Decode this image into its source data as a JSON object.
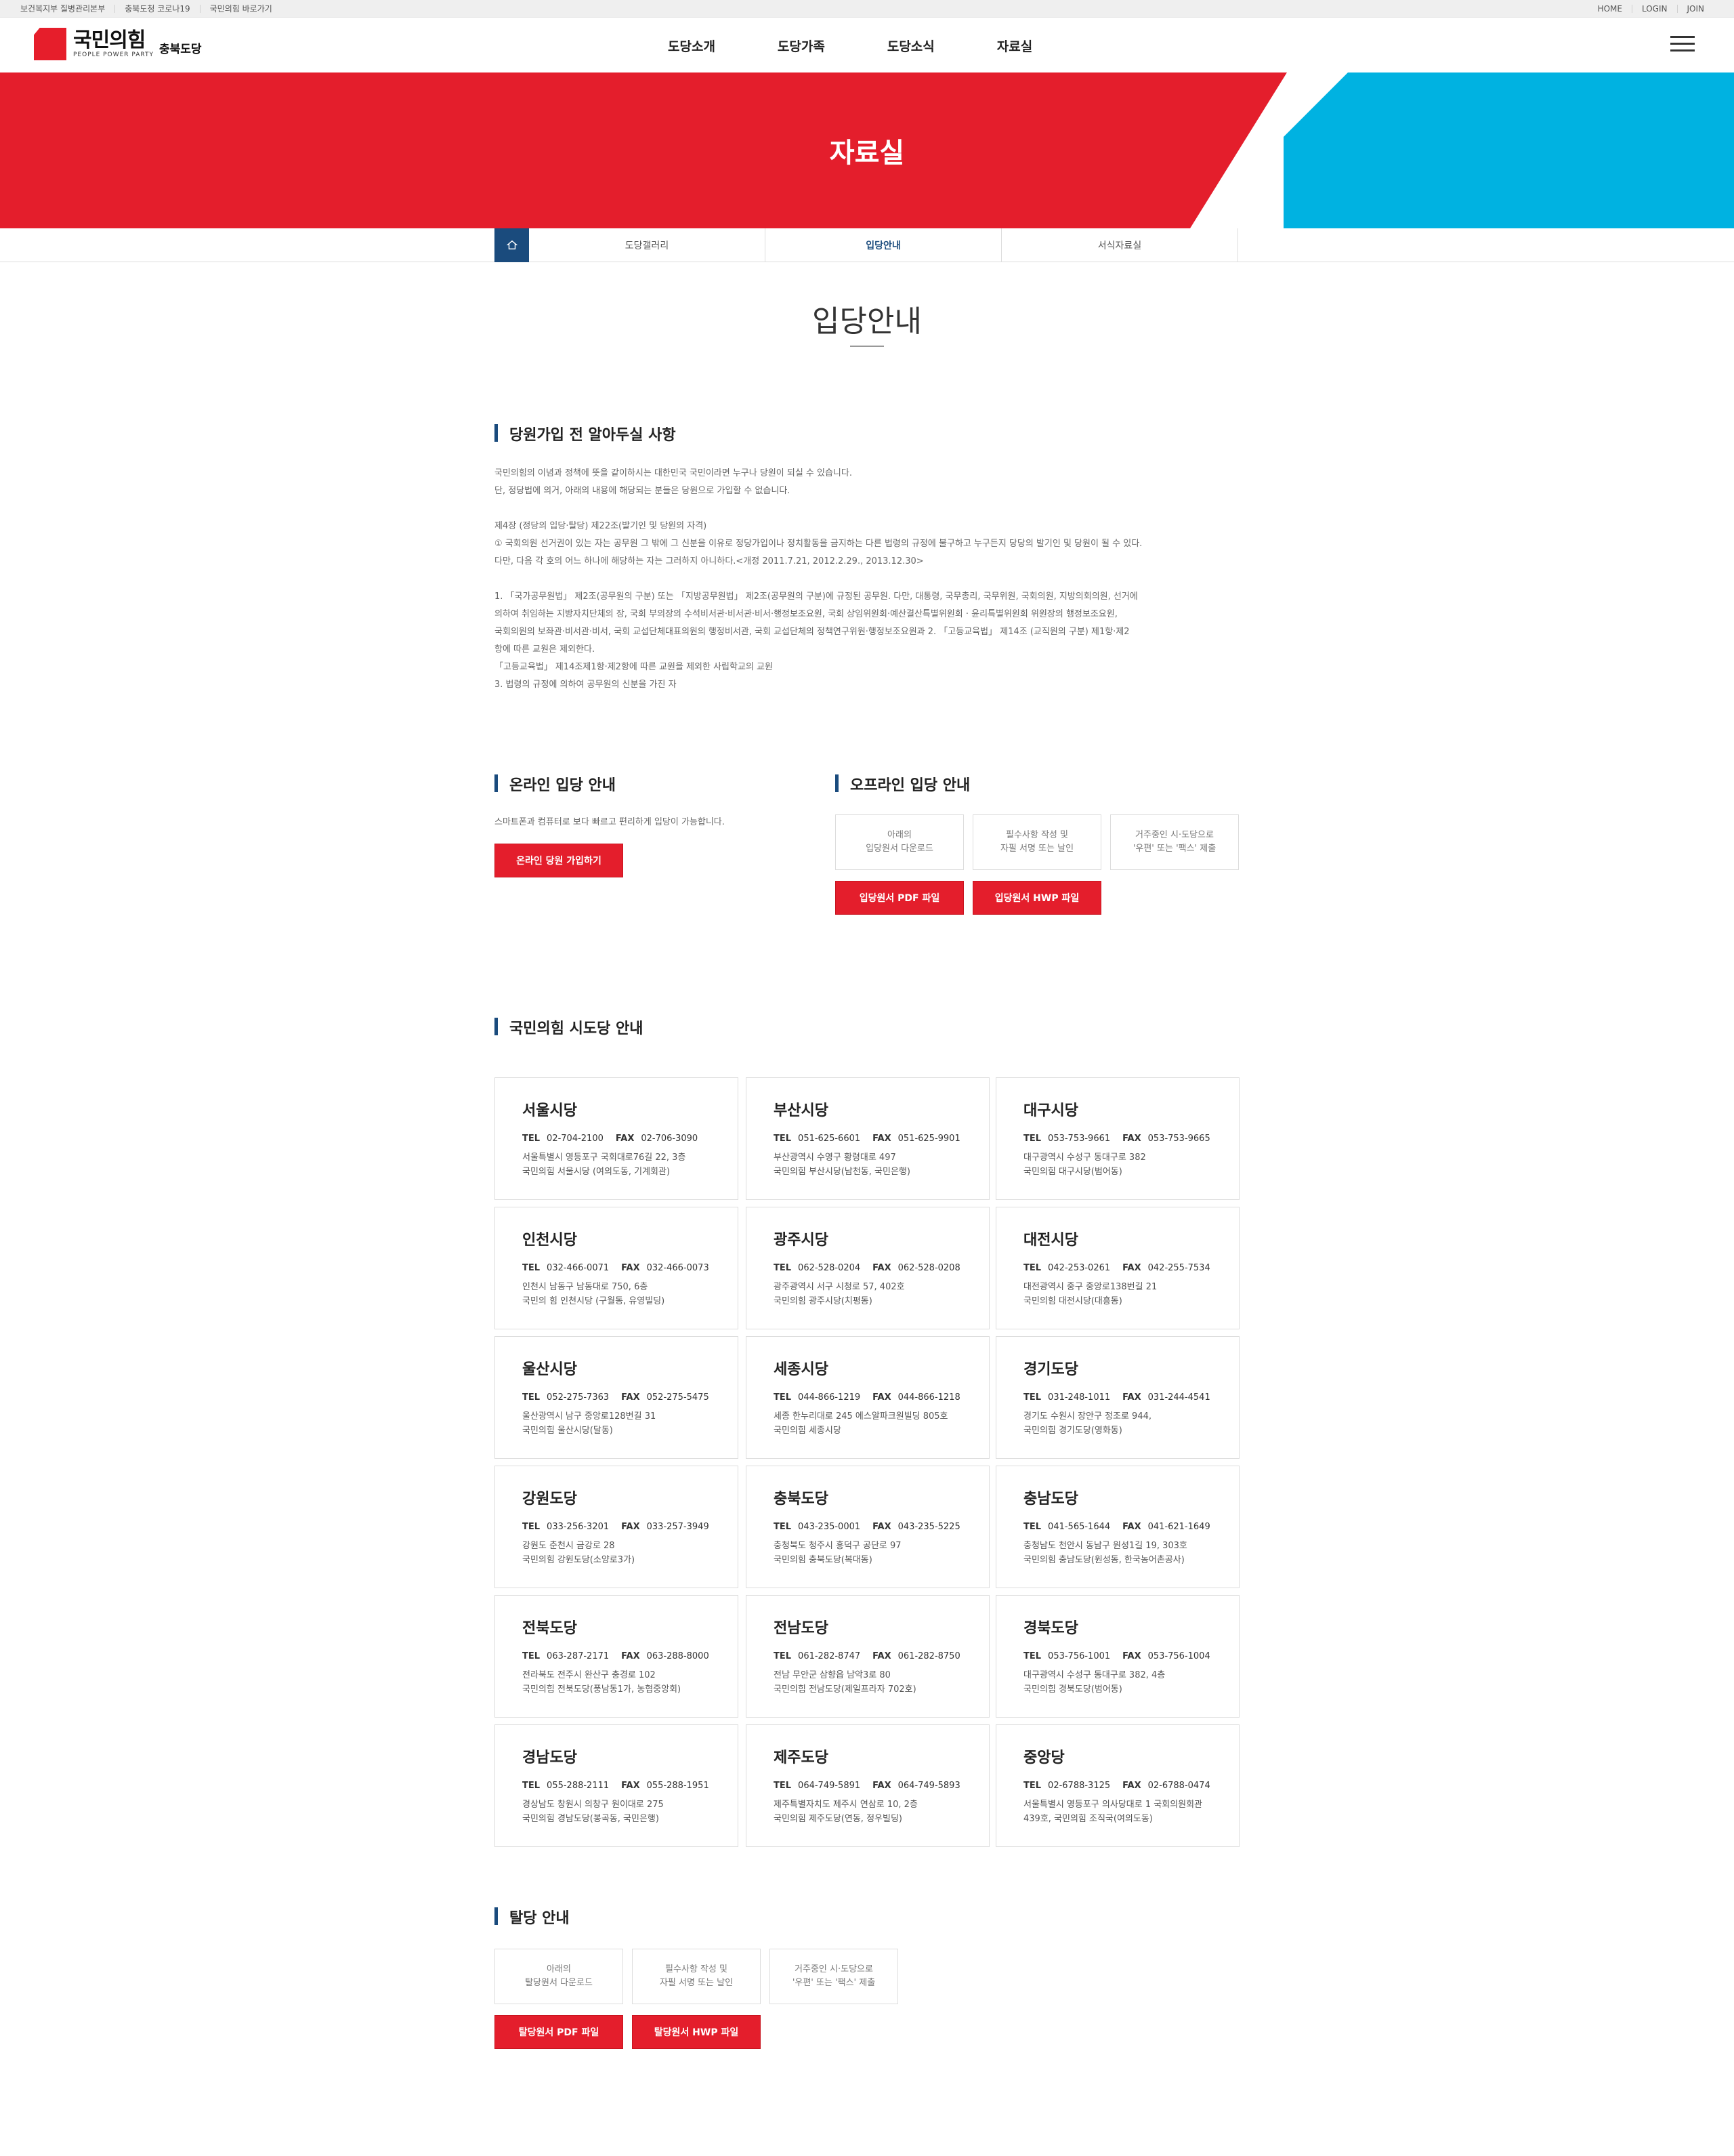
{
  "topbar": {
    "left_links": [
      "보건복지부 질병관리본부",
      "충북도청 코로나19",
      "국민의힘 바로가기"
    ],
    "right_links": [
      "HOME",
      "LOGIN",
      "JOIN"
    ]
  },
  "header": {
    "logo_ko": "국민의힘",
    "logo_en": "PEOPLE POWER PARTY",
    "logo_sub": "충북도당",
    "gnb": [
      "도당소개",
      "도당가족",
      "도당소식",
      "자료실"
    ]
  },
  "banner": {
    "title": "자료실"
  },
  "subnav": {
    "items": [
      "도당갤러리",
      "입당안내",
      "서식자료실"
    ],
    "active_index": 1
  },
  "page": {
    "title": "입당안내"
  },
  "notice": {
    "heading": "당원가입 전 알아두실 사항",
    "lines": [
      "국민의힘의 이념과 정책에 뜻을 같이하시는 대한민국 국민이라면 누구나 당원이 되실 수 있습니다.",
      "단, 정당법에 의거, 아래의 내용에 해당되는 분들은 당원으로 가입할 수 없습니다.",
      "",
      "제4장 (정당의 입당·탈당) 제22조(발기인 및 당원의 자격)",
      "① 국회의원 선거권이 있는 자는 공무원 그 밖에 그 신분을 이유로 정당가입이나 정치활동을 금지하는 다른 법령의 규정에 불구하고 누구든지 당당의 발기인 및 당원이 될 수 있다.",
      "다만, 다음 각 호의 어느 하나에 해당하는 자는 그러하지 아니하다.<개정 2011.7.21, 2012.2.29., 2013.12.30>",
      "",
      "1. 「국가공무원법」 제2조(공무원의 구분) 또는 「지방공무원법」 제2조(공무원의 구분)에 규정된 공무원. 다만, 대통령, 국무총리, 국무위원, 국회의원, 지방의회의원, 선거에",
      "의하여 취임하는 지방자치단체의 장, 국회 부의장의 수석비서관·비서관·비서·행정보조요원, 국회 상임위원회·예산결산특별위원회 · 윤리특별위원회 위원장의 행정보조요원,",
      "국회의원의 보좌관·비서관·비서, 국회 교섭단체대표의원의 행정비서관, 국회 교섭단체의 정책연구위원·행정보조요원과 2. 「고등교육법」 제14조 (교직원의 구분) 제1항·제2",
      "항에 따른 교원은 제외한다.",
      "「고등교육법」 제14조제1항·제2항에 따른 교원을 제외한 사립학교의 교원",
      "3. 법령의 규정에 의하여 공무원의 신분을 가진 자"
    ]
  },
  "online": {
    "heading": "온라인 입당 안내",
    "desc": "스마트폰과 컴퓨터로 보다 빠르고 편리하게 입당이 가능합니다.",
    "button": "온라인 당원 가입하기"
  },
  "offline": {
    "heading": "오프라인 입당 안내",
    "steps": [
      [
        "아래의",
        "입당원서 다운로드"
      ],
      [
        "필수사항 작성 및",
        "자필 서명 또는 날인"
      ],
      [
        "거주중인 시·도당으로",
        "'우편' 또는 '팩스' 제출"
      ]
    ],
    "buttons": [
      "입당원서 PDF 파일",
      "입당원서 HWP 파일"
    ]
  },
  "offices": {
    "heading": "국민의힘 시도당 안내",
    "tel_label": "TEL",
    "fax_label": "FAX",
    "list": [
      {
        "name": "서울시당",
        "tel": "02-704-2100",
        "fax": "02-706-3090",
        "addr1": "서울특별시 영등포구 국회대로76길 22, 3층",
        "addr2": "국민의힘 서울시당 (여의도동, 기계회관)"
      },
      {
        "name": "부산시당",
        "tel": "051-625-6601",
        "fax": "051-625-9901",
        "addr1": "부산광역시 수영구 황령대로 497",
        "addr2": "국민의힘 부산시당(남천동, 국민은행)"
      },
      {
        "name": "대구시당",
        "tel": "053-753-9661",
        "fax": "053-753-9665",
        "addr1": "대구광역시 수성구 동대구로 382",
        "addr2": "국민의힘 대구시당(범어동)"
      },
      {
        "name": "인천시당",
        "tel": "032-466-0071",
        "fax": "032-466-0073",
        "addr1": "인천시 남동구 남동대로 750, 6층",
        "addr2": "국민의 힘 인천시당 (구월동, 유영빌딩)"
      },
      {
        "name": "광주시당",
        "tel": "062-528-0204",
        "fax": "062-528-0208",
        "addr1": "광주광역시 서구 시청로 57, 402호",
        "addr2": "국민의힘 광주시당(치평동)"
      },
      {
        "name": "대전시당",
        "tel": "042-253-0261",
        "fax": "042-255-7534",
        "addr1": "대전광역시 중구 중앙로138번길 21",
        "addr2": "국민의힘 대전시당(대흥동)"
      },
      {
        "name": "울산시당",
        "tel": "052-275-7363",
        "fax": "052-275-5475",
        "addr1": "울산광역시 남구 중앙로128번길 31",
        "addr2": "국민의힘 울산시당(달동)"
      },
      {
        "name": "세종시당",
        "tel": "044-866-1219",
        "fax": "044-866-1218",
        "addr1": "세종 한누리대로 245 에스알파크원빌딩 805호",
        "addr2": "국민의힘 세종시당"
      },
      {
        "name": "경기도당",
        "tel": "031-248-1011",
        "fax": "031-244-4541",
        "addr1": "경기도 수원시 장안구 정조로 944,",
        "addr2": "국민의힘 경기도당(영화동)"
      },
      {
        "name": "강원도당",
        "tel": "033-256-3201",
        "fax": "033-257-3949",
        "addr1": "강원도 춘천시 금강로 28",
        "addr2": "국민의힘 강원도당(소양로3가)"
      },
      {
        "name": "충북도당",
        "tel": "043-235-0001",
        "fax": "043-235-5225",
        "addr1": "충청북도 청주시 흥덕구 공단로 97",
        "addr2": "국민의힘 충북도당(복대동)"
      },
      {
        "name": "충남도당",
        "tel": "041-565-1644",
        "fax": "041-621-1649",
        "addr1": "충청남도 천안시 동남구 원성1길 19, 303호",
        "addr2": "국민의힘 충남도당(원성동, 한국농어촌공사)"
      },
      {
        "name": "전북도당",
        "tel": "063-287-2171",
        "fax": "063-288-8000",
        "addr1": "전라북도 전주시 완산구 충경로 102",
        "addr2": "국민의힘 전북도당(풍남동1가, 농협중앙회)"
      },
      {
        "name": "전남도당",
        "tel": "061-282-8747",
        "fax": "061-282-8750",
        "addr1": "전남 무안군 삼향읍 남악3로 80",
        "addr2": "국민의힘 전남도당(제일프라자 702호)"
      },
      {
        "name": "경북도당",
        "tel": "053-756-1001",
        "fax": "053-756-1004",
        "addr1": "대구광역시 수성구 동대구로 382, 4층",
        "addr2": "국민의힘 경북도당(범어동)"
      },
      {
        "name": "경남도당",
        "tel": "055-288-2111",
        "fax": "055-288-1951",
        "addr1": "경상남도 창원시 의창구 원이대로 275",
        "addr2": "국민의힘 경남도당(봉곡동, 국민은행)"
      },
      {
        "name": "제주도당",
        "tel": "064-749-5891",
        "fax": "064-749-5893",
        "addr1": "제주특별자치도 제주시 연삼로 10, 2층",
        "addr2": "국민의힘 제주도당(연동, 정우빌딩)"
      },
      {
        "name": "중앙당",
        "tel": "02-6788-3125",
        "fax": "02-6788-0474",
        "addr1": "서울특별시 영등포구 의사당대로 1 국회의원회관",
        "addr2": "439호, 국민의힘 조직국(여의도동)"
      }
    ]
  },
  "withdraw": {
    "heading": "탈당 안내",
    "steps": [
      [
        "아래의",
        "탈당원서 다운로드"
      ],
      [
        "필수사항 작성 및",
        "자필 서명 또는 날인"
      ],
      [
        "거주중인 시·도당으로",
        "'우편' 또는 '팩스' 제출"
      ]
    ],
    "buttons": [
      "탈당원서 PDF 파일",
      "탈당원서 HWP 파일"
    ]
  },
  "colors": {
    "red": "#e41e2c",
    "blue": "#00b2e1",
    "navy": "#1a4b7d"
  }
}
